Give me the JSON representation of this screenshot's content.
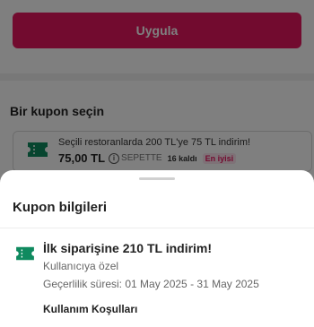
{
  "apply_button": {
    "label": "Uygula"
  },
  "coupon_section": {
    "title": "Bir kupon seçin",
    "card": {
      "description": "Seçili restoranlarda 200 TL'ye 75 TL indirim!",
      "price": "75,00 TL",
      "status": "SEPETTE",
      "remaining": "16 kaldı",
      "badge": "En iyisi",
      "icon": "ticket-icon"
    }
  },
  "sheet": {
    "title": "Kupon bilgileri",
    "coupon": {
      "title": "İlk siparişine 210 TL indirim!",
      "subtitle": "Kullanıcıya özel",
      "validity": "Geçerlilik süresi: 01 May 2025 - 31 May 2025",
      "icon": "ticket-icon"
    },
    "terms_heading": "Kullanım Koşulları"
  },
  "colors": {
    "brand": "#e5175f",
    "ticket": "#0f8a5f"
  }
}
